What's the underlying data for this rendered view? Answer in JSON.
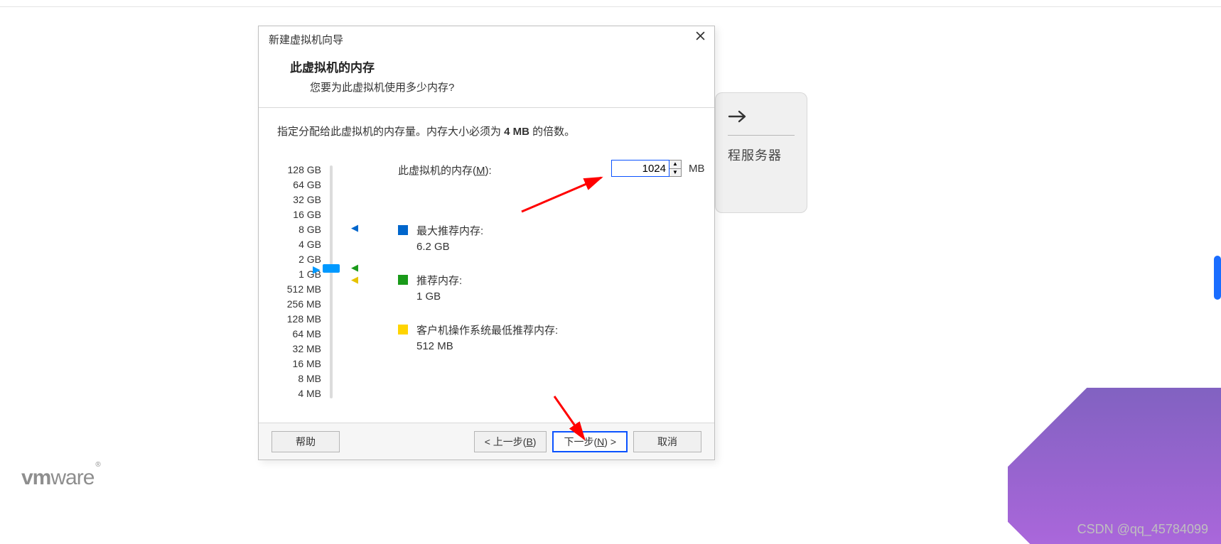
{
  "dialog": {
    "title": "新建虚拟机向导",
    "heading": "此虚拟机的内存",
    "subheading": "您要为此虚拟机使用多少内存?",
    "instruction_pre": "指定分配给此虚拟机的内存量。内存大小必须为 ",
    "instruction_bold": "4 MB",
    "instruction_post": " 的倍数。",
    "memory_label_pre": "此虚拟机的内存(",
    "memory_label_key": "M",
    "memory_label_post": "):",
    "memory_value": "1024",
    "memory_unit": "MB",
    "ticks": [
      "128 GB",
      "64 GB",
      "32 GB",
      "16 GB",
      "8 GB",
      "4 GB",
      "2 GB",
      "1 GB",
      "512 MB",
      "256 MB",
      "128 MB",
      "64 MB",
      "32 MB",
      "16 MB",
      "8 MB",
      "4 MB"
    ],
    "legend": {
      "max": {
        "label": "最大推荐内存:",
        "value": "6.2 GB"
      },
      "rec": {
        "label": "推荐内存:",
        "value": "1 GB"
      },
      "min": {
        "label": "客户机操作系统最低推荐内存:",
        "value": "512 MB"
      }
    },
    "buttons": {
      "help": "帮助",
      "back_pre": "< 上一步(",
      "back_key": "B",
      "back_post": ")",
      "next_pre": "下一步(",
      "next_key": "N",
      "next_post": ") >",
      "cancel": "取消"
    }
  },
  "bg_card": {
    "label": "程服务器"
  },
  "watermark": "CSDN @qq_45784099",
  "logo": {
    "vm": "vm",
    "ware": "ware",
    "reg": "®"
  }
}
